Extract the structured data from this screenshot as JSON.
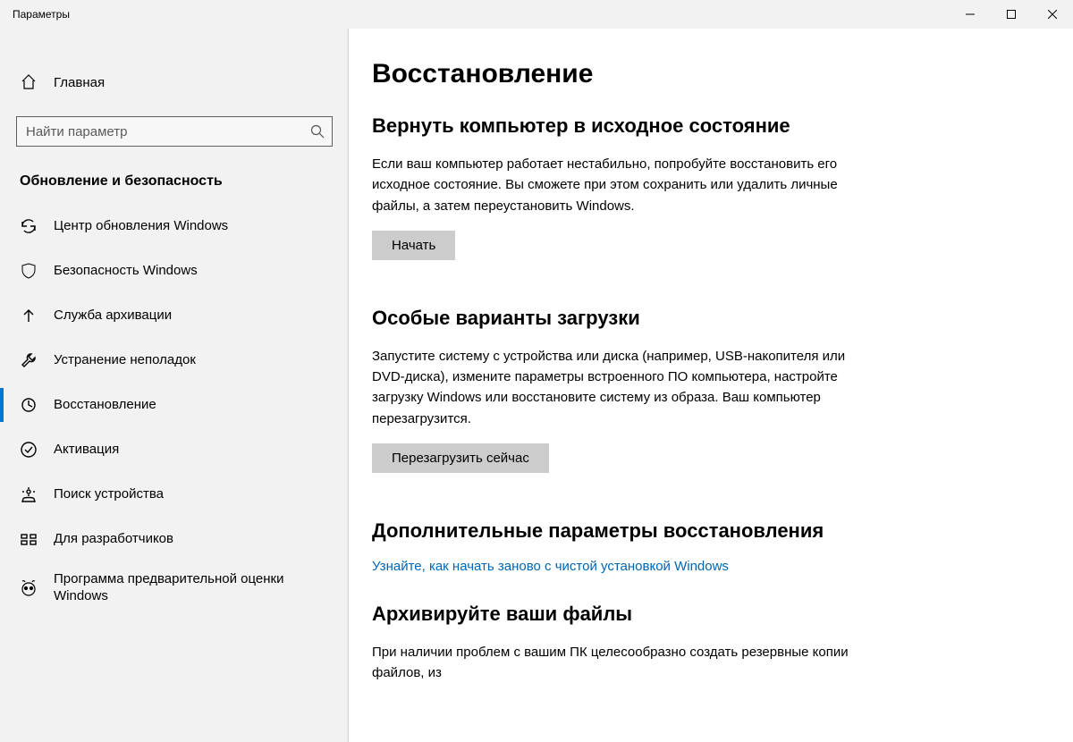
{
  "window": {
    "title": "Параметры"
  },
  "sidebar": {
    "home": "Главная",
    "search_placeholder": "Найти параметр",
    "section": "Обновление и безопасность",
    "items": [
      {
        "label": "Центр обновления Windows"
      },
      {
        "label": "Безопасность Windows"
      },
      {
        "label": "Служба архивации"
      },
      {
        "label": "Устранение неполадок"
      },
      {
        "label": "Восстановление"
      },
      {
        "label": "Активация"
      },
      {
        "label": "Поиск устройства"
      },
      {
        "label": "Для разработчиков"
      },
      {
        "label": "Программа предварительной оценки Windows"
      }
    ]
  },
  "main": {
    "title": "Восстановление",
    "reset": {
      "heading": "Вернуть компьютер в исходное состояние",
      "text": "Если ваш компьютер работает нестабильно, попробуйте восстановить его исходное состояние. Вы сможете при этом сохранить или удалить личные файлы, а затем переустановить Windows.",
      "button": "Начать"
    },
    "startup": {
      "heading": "Особые варианты загрузки",
      "text": "Запустите систему с устройства или диска (например, USB-накопителя или DVD-диска), измените параметры встроенного ПО компьютера, настройте загрузку Windows или восстановите систему из образа. Ваш компьютер перезагрузится.",
      "button": "Перезагрузить сейчас"
    },
    "more": {
      "heading": "Дополнительные параметры восстановления",
      "link": "Узнайте, как начать заново с чистой установкой Windows"
    },
    "backup": {
      "heading": "Архивируйте ваши файлы",
      "text": "При наличии проблем с вашим ПК целесообразно создать резервные копии файлов, из"
    }
  }
}
